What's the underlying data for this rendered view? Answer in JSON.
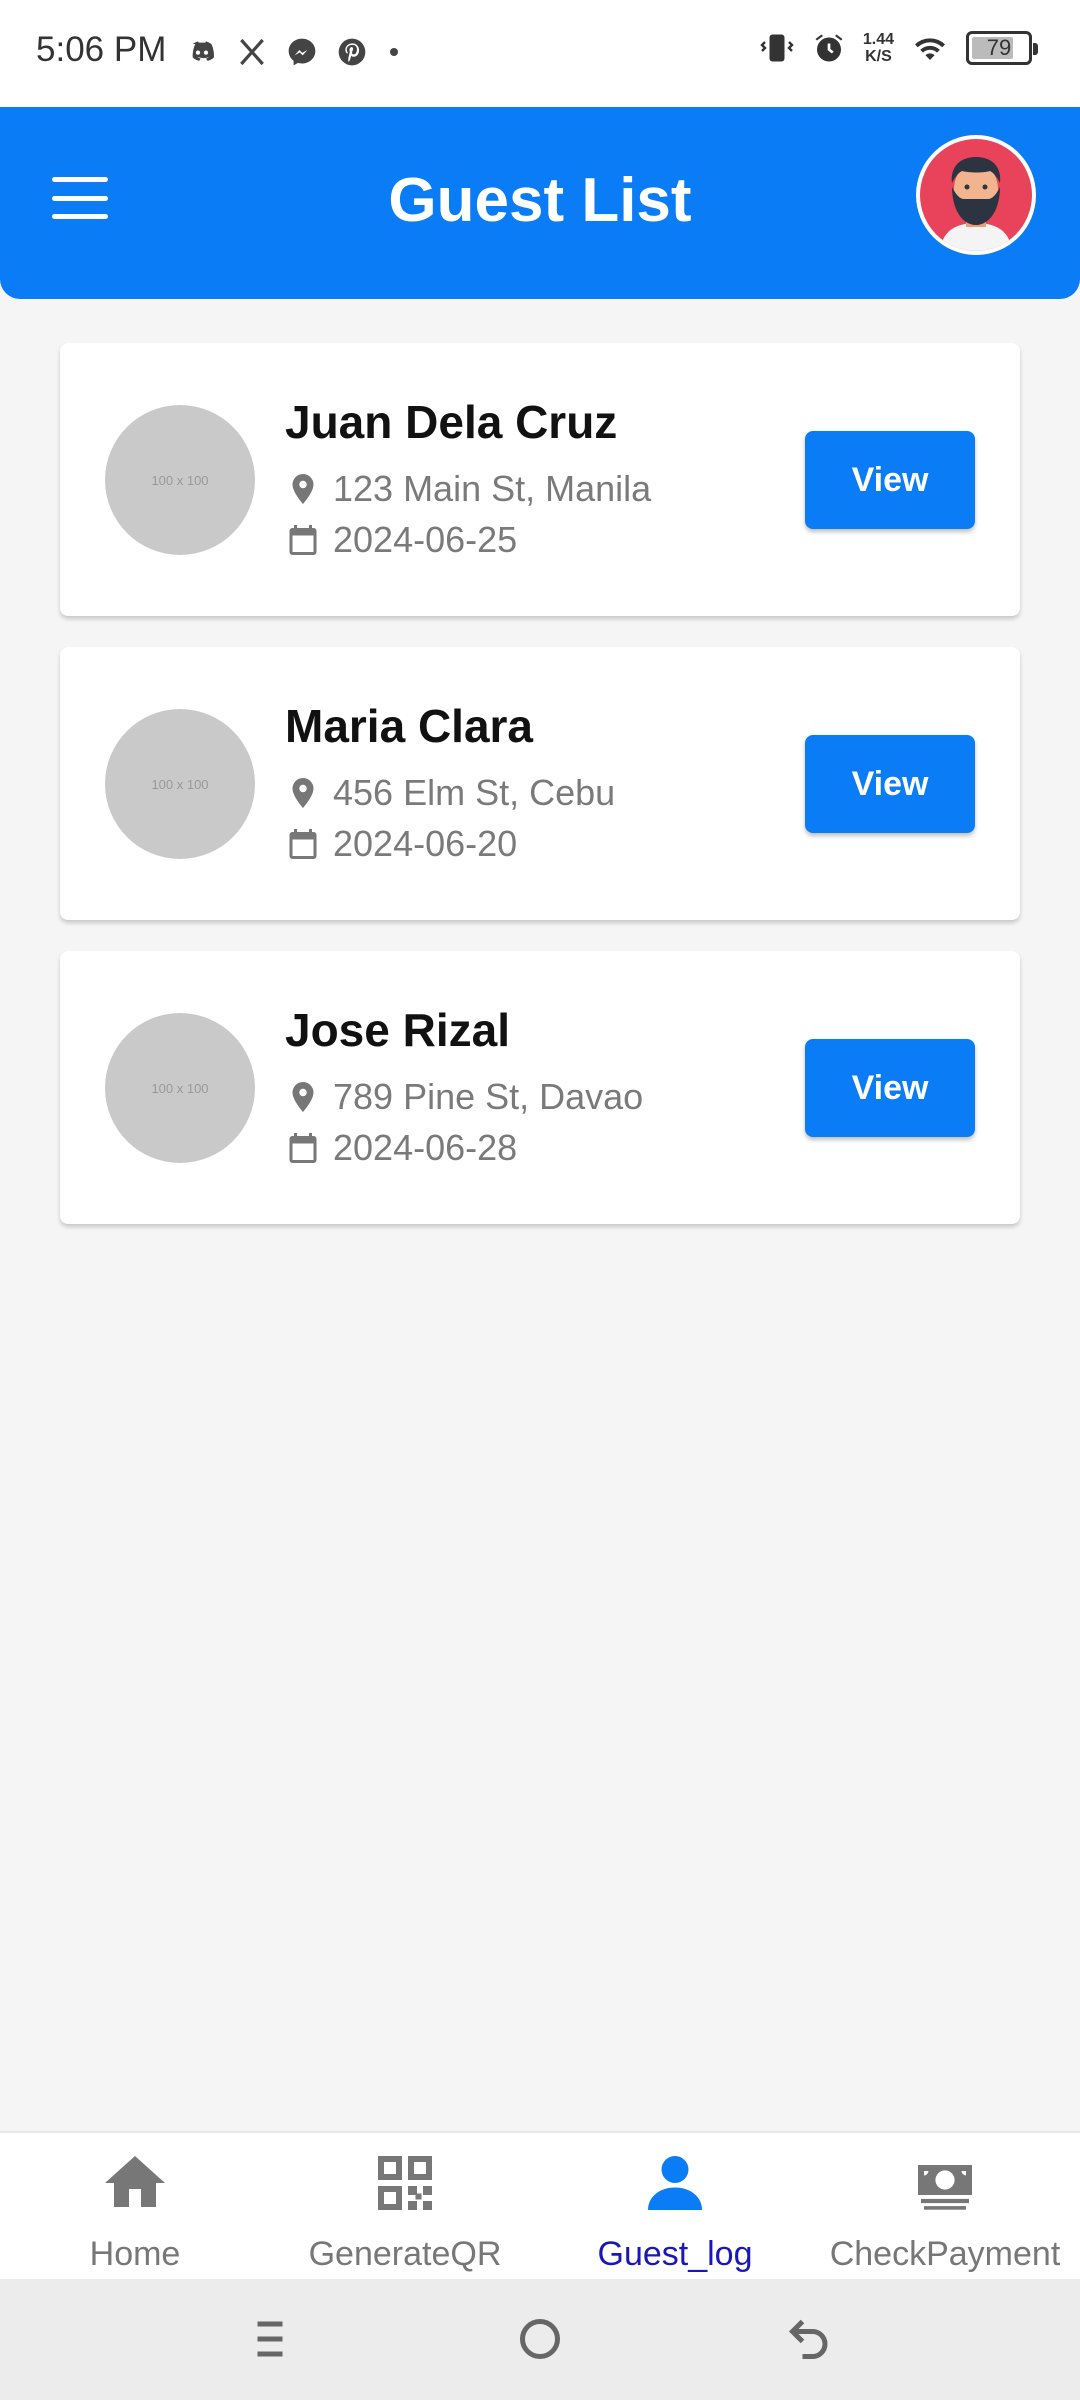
{
  "status_bar": {
    "time": "5:06 PM",
    "net_speed_value": "1.44",
    "net_speed_unit": "K/S",
    "battery": "79",
    "battery_level": 0.79,
    "left_icons": [
      "discord-icon",
      "x-icon",
      "messenger-icon",
      "pinterest-icon",
      "dot-icon"
    ],
    "right_icons": [
      "vibrate-icon",
      "alarm-icon",
      "wifi-icon",
      "battery-icon"
    ]
  },
  "header": {
    "title": "Guest List",
    "bg_color": "#0a7cf5"
  },
  "guests": [
    {
      "name": "Juan Dela Cruz",
      "address": "123 Main St, Manila",
      "date": "2024-06-25",
      "photo_text": "100 x 100",
      "button": "View"
    },
    {
      "name": "Maria Clara",
      "address": "456 Elm St, Cebu",
      "date": "2024-06-20",
      "photo_text": "100 x 100",
      "button": "View"
    },
    {
      "name": "Jose Rizal",
      "address": "789 Pine St, Davao",
      "date": "2024-06-28",
      "photo_text": "100 x 100",
      "button": "View"
    }
  ],
  "bottom_nav": {
    "items": [
      {
        "label": "Home",
        "icon": "home-icon",
        "active": false
      },
      {
        "label": "GenerateQR",
        "icon": "qr-code-icon",
        "active": false
      },
      {
        "label": "Guest_log",
        "icon": "person-icon",
        "active": true
      },
      {
        "label": "CheckPayment",
        "icon": "payment-icon",
        "active": false
      }
    ],
    "active_color": "#0a7cf5"
  }
}
